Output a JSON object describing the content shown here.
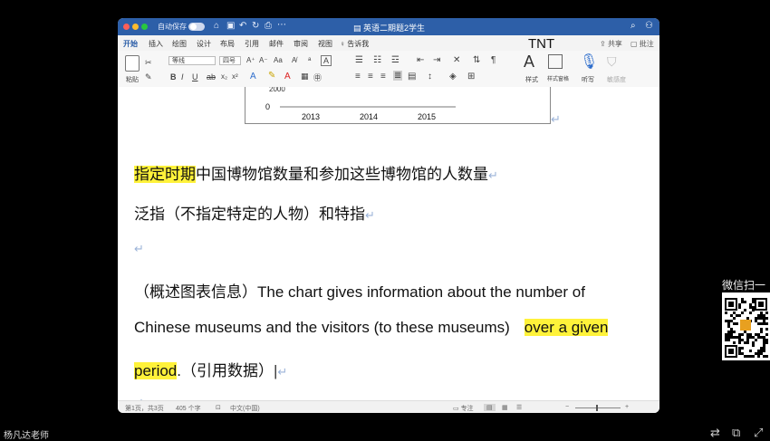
{
  "window": {
    "autosave_label": "自动保存",
    "doc_title": "英语二期题2学生",
    "tnt_label": "TNT",
    "menu": [
      "开始",
      "插入",
      "绘图",
      "设计",
      "布局",
      "引用",
      "邮件",
      "审阅",
      "视图",
      "告诉我"
    ],
    "share_label": "共享",
    "comments_label": "批注",
    "ribbon": {
      "paste": "粘贴",
      "font_name": "等线",
      "font_size": "四号",
      "styles": "样式",
      "style_pane": "样式窗格",
      "dictate": "听写",
      "sensitivity": "敏感度"
    }
  },
  "chart_data": {
    "type": "bar",
    "categories": [
      "2013",
      "2014",
      "2015"
    ],
    "y_ticks_visible": [
      "2000",
      "0"
    ]
  },
  "document": {
    "line1_highlight": "指定时期",
    "line1_rest": "中国博物馆数量和参加这些博物馆的人数量",
    "line2": "泛指（不指定特定的人物）和特指",
    "line3_part1": "（概述图表信息）The chart gives information about the number of",
    "line4_part1": "Chinese museums and the visitors (to these museums)",
    "line4_highlight": "over a given",
    "line5_highlight": "period",
    "line5_rest": ".（引用数据）"
  },
  "statusbar": {
    "page": "第1页，共3页",
    "words": "405 个字",
    "language": "中文(中国)",
    "focus": "专注"
  },
  "overlay": {
    "qr_label": "微信扫一",
    "teacher_name": "杨凡达老师"
  }
}
